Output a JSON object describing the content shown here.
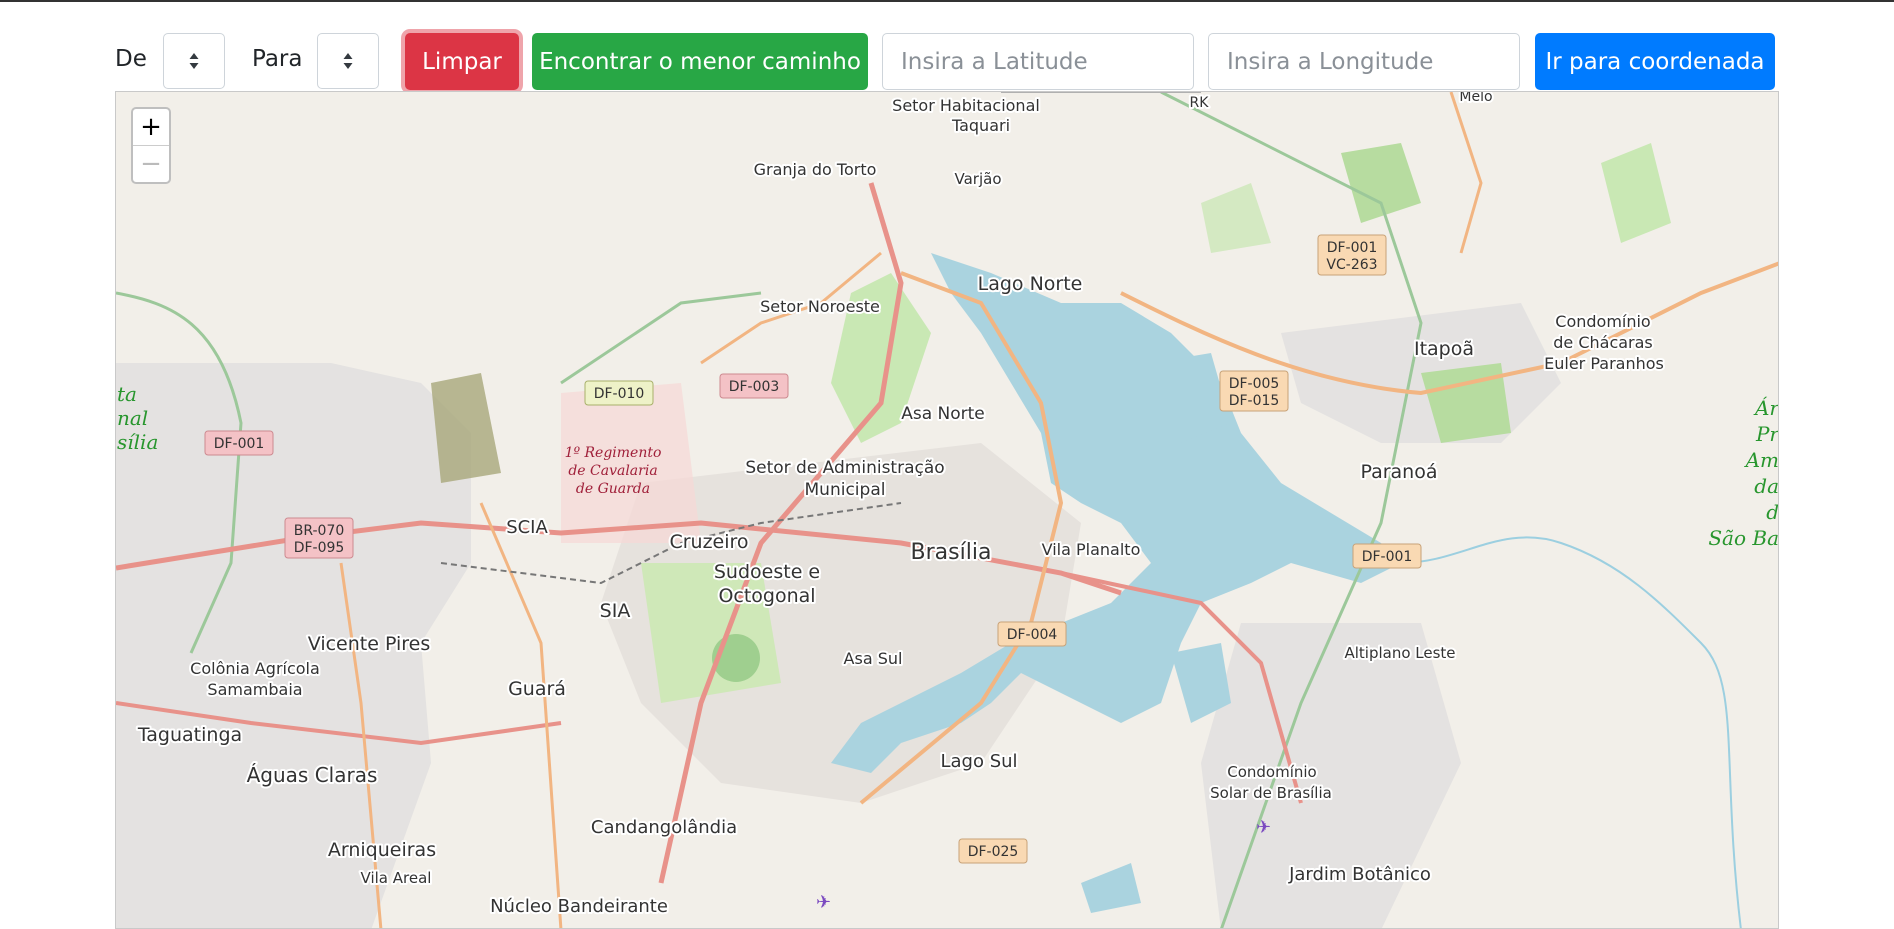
{
  "toolbar": {
    "from_label": "De",
    "to_label": "Para",
    "clear_label": "Limpar",
    "find_path_label": "Encontrar o menor caminho",
    "latitude_placeholder": "Insira a Latitude",
    "longitude_placeholder": "Insira a Longitude",
    "goto_label": "Ir para coordenada"
  },
  "zoom": {
    "in_label": "+",
    "out_label": "−"
  },
  "map": {
    "places": [
      "Setor Habitacional",
      "Taquari",
      "Granja do Torto",
      "Varjão",
      "Lago Norte",
      "Setor Noroeste",
      "Itapoã",
      "Condomínio",
      "de Chácaras",
      "Euler Paranhos",
      "Asa Norte",
      "Setor de Administração",
      "Municipal",
      "Paranoá",
      "SCIA",
      "Cruzeiro",
      "Brasília",
      "Vila Planalto",
      "Sudoeste e",
      "Octogonal",
      "SIA",
      "Vicente Pires",
      "Colônia Agrícola",
      "Samambaia",
      "Asa Sul",
      "Altiplano Leste",
      "Guará",
      "Taguatinga",
      "Águas Claras",
      "Lago Sul",
      "Condomínio",
      "Solar de Brasília",
      "Candangolândia",
      "Arniqueiras",
      "Vila Areal",
      "Jardim Botânico",
      "Núcleo Bandeirante",
      "RK",
      "Melo"
    ],
    "military": [
      "1º Regimento",
      "de Cavalaria",
      "de Guarda"
    ],
    "park_left": [
      "ta",
      "nal",
      "sília"
    ],
    "park_right": [
      "Ár",
      "Pr",
      "Am",
      "da",
      "d",
      "São Ba"
    ],
    "shields": [
      "DF-001",
      "VC-263",
      "DF-005",
      "DF-015",
      "DF-010",
      "DF-003",
      "DF-001",
      "BR-070",
      "DF-095",
      "DF-001",
      "DF-004",
      "DF-025"
    ]
  }
}
